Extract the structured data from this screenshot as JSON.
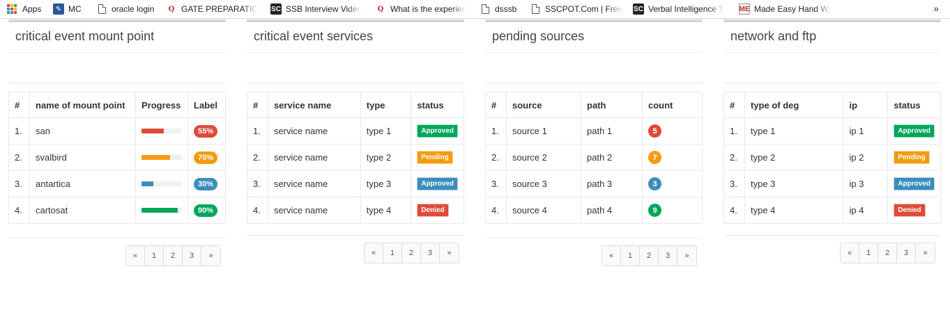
{
  "bookmarks": [
    {
      "label": "Apps",
      "icon": "apps-grid-icon"
    },
    {
      "label": "MC",
      "icon": "mc-icon"
    },
    {
      "label": "oracle login",
      "icon": "page-icon"
    },
    {
      "label": "GATE PREPARATION",
      "icon": "quora-icon"
    },
    {
      "label": "SSB Interview Video",
      "icon": "sc-icon"
    },
    {
      "label": "What is the experien",
      "icon": "quora-icon"
    },
    {
      "label": "dsssb",
      "icon": "page-icon"
    },
    {
      "label": "SSCPOT.Com | Free S",
      "icon": "page-icon"
    },
    {
      "label": "Verbal Intelligence T",
      "icon": "sc-icon"
    },
    {
      "label": "Made Easy Hand Wri",
      "icon": "made-easy-icon"
    }
  ],
  "more_label": "»",
  "colors": {
    "red": "#dd4b39",
    "orange": "#f39c12",
    "blue": "#3c8dbc",
    "green": "#00a65a"
  },
  "panels": [
    {
      "title": "critical event mount point",
      "headers": [
        "#",
        "name of mount point",
        "Progress",
        "Label"
      ],
      "rows": [
        {
          "idx": "1.",
          "name": "san",
          "progress": 0.55,
          "label": "55%",
          "color": "#dd4b39"
        },
        {
          "idx": "2.",
          "name": "svalbird",
          "progress": 0.7,
          "label": "70%",
          "color": "#f39c12"
        },
        {
          "idx": "3.",
          "name": "antartica",
          "progress": 0.3,
          "label": "30%",
          "color": "#3c8dbc"
        },
        {
          "idx": "4.",
          "name": "cartosat",
          "progress": 0.9,
          "label": "90%",
          "color": "#00a65a"
        }
      ],
      "pager": [
        "«",
        "1",
        "2",
        "3",
        "»"
      ]
    },
    {
      "title": "critical event services",
      "headers": [
        "#",
        "service name",
        "type",
        "status"
      ],
      "rows": [
        {
          "idx": "1.",
          "name": "service name",
          "type": "type 1",
          "status": "Approved",
          "color": "#00a65a"
        },
        {
          "idx": "2.",
          "name": "service name",
          "type": "type 2",
          "status": "Pending",
          "color": "#f39c12"
        },
        {
          "idx": "3.",
          "name": "service name",
          "type": "type 3",
          "status": "Approved",
          "color": "#3c8dbc"
        },
        {
          "idx": "4.",
          "name": "service name",
          "type": "type 4",
          "status": "Denied",
          "color": "#dd4b39"
        }
      ],
      "pager": [
        "«",
        "1",
        "2",
        "3",
        "»"
      ]
    },
    {
      "title": "pending sources",
      "headers": [
        "#",
        "source",
        "path",
        "count"
      ],
      "rows": [
        {
          "idx": "1.",
          "name": "source 1",
          "type": "path 1",
          "count": "5",
          "color": "#dd4b39"
        },
        {
          "idx": "2.",
          "name": "source 2",
          "type": "path 2",
          "count": "7",
          "color": "#f39c12"
        },
        {
          "idx": "3.",
          "name": "source 3",
          "type": "path 3",
          "count": "3",
          "color": "#3c8dbc"
        },
        {
          "idx": "4.",
          "name": "source 4",
          "type": "path 4",
          "count": "9",
          "color": "#00a65a"
        }
      ],
      "pager": [
        "«",
        "1",
        "2",
        "3",
        "»"
      ]
    },
    {
      "title": "network and ftp",
      "headers": [
        "#",
        "type of deg",
        "ip",
        "status"
      ],
      "rows": [
        {
          "idx": "1.",
          "name": "type 1",
          "type": "ip 1",
          "status": "Approved",
          "color": "#00a65a"
        },
        {
          "idx": "2.",
          "name": "type 2",
          "type": "ip 2",
          "status": "Pending",
          "color": "#f39c12"
        },
        {
          "idx": "3.",
          "name": "type 3",
          "type": "ip 3",
          "status": "Approved",
          "color": "#3c8dbc"
        },
        {
          "idx": "4.",
          "name": "type 4",
          "type": "ip 4",
          "status": "Denied",
          "color": "#dd4b39"
        }
      ],
      "pager": [
        "«",
        "1",
        "2",
        "3",
        "»"
      ]
    }
  ]
}
